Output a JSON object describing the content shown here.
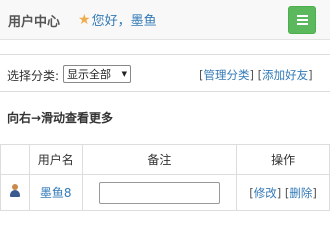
{
  "header": {
    "brand": "用户中心",
    "greeting": "您好，墨鱼",
    "star_icon": "star-icon",
    "menu_icon": "hamburger-menu-icon",
    "accent_color": "#5cb85c"
  },
  "filter": {
    "label": "选择分类:",
    "selected": "显示全部",
    "link_manage": "管理分类",
    "link_add_friend": "添加好友"
  },
  "hint": "向右→滑动查看更多",
  "table": {
    "headers": [
      "",
      "用户名",
      "备注",
      "操作"
    ],
    "rows": [
      {
        "name": "墨鱼8",
        "note": "",
        "edit": "修改",
        "delete": "删除"
      }
    ]
  }
}
